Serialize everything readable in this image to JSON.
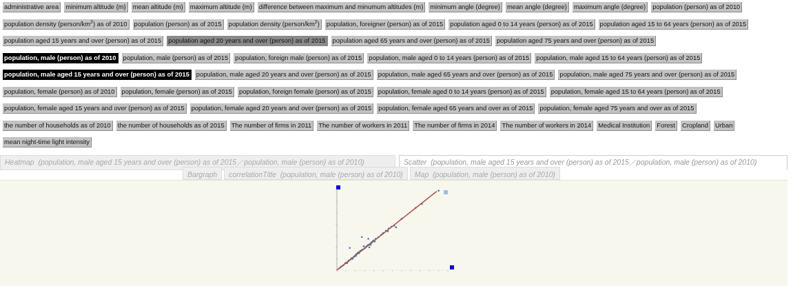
{
  "tag_rows": [
    [
      {
        "label": "administrative area",
        "selected": false,
        "highlighted": false
      },
      {
        "label": "minimum altitude (m)",
        "selected": false,
        "highlighted": false
      },
      {
        "label": "mean altitude (m)",
        "selected": false,
        "highlighted": false
      },
      {
        "label": "maximum altitude (m)",
        "selected": false,
        "highlighted": false
      },
      {
        "label": "difference between maximum and minumum altitudes (m)",
        "selected": false,
        "highlighted": false
      },
      {
        "label": "minimum angle (degree)",
        "selected": false,
        "highlighted": false
      },
      {
        "label": "mean angle (degree)",
        "selected": false,
        "highlighted": false
      },
      {
        "label": "maximum angle (degree)",
        "selected": false,
        "highlighted": false
      },
      {
        "label": "population (person) as of 2010",
        "selected": false,
        "highlighted": false
      }
    ],
    [
      {
        "label": "population density (person/km$^{2}$) as of 2010",
        "selected": false,
        "highlighted": false
      },
      {
        "label": "population (person) as of 2015",
        "selected": false,
        "highlighted": false
      },
      {
        "label": "population density (person/km$^{2}$)",
        "selected": false,
        "highlighted": false
      },
      {
        "label": "population, foreigner (person) as of 2015",
        "selected": false,
        "highlighted": false
      },
      {
        "label": "population aged 0 to 14 years (person) as of 2015",
        "selected": false,
        "highlighted": false
      },
      {
        "label": "population aged 15 to 64 years (person) as of 2015",
        "selected": false,
        "highlighted": false
      }
    ],
    [
      {
        "label": "population aged 15 years and over (person) as of 2015",
        "selected": false,
        "highlighted": false
      },
      {
        "label": "population aged 20 years and over (person) as of 2015",
        "selected": false,
        "highlighted": true
      },
      {
        "label": "population aged 65 years and over (person) as of 2015",
        "selected": false,
        "highlighted": false
      },
      {
        "label": "population aged 75 years and over (person) as of 2015",
        "selected": false,
        "highlighted": false
      }
    ],
    [
      {
        "label": "population, male (person) as of 2010",
        "selected": true,
        "highlighted": false
      },
      {
        "label": "population, male (person) as of 2015",
        "selected": false,
        "highlighted": false
      },
      {
        "label": "population, foreign male (person) as of 2015",
        "selected": false,
        "highlighted": false
      },
      {
        "label": "population, male aged 0 to 14 years (person) as of 2015",
        "selected": false,
        "highlighted": false
      },
      {
        "label": "population, male aged 15 to 64 years (person) as of 2015",
        "selected": false,
        "highlighted": false
      }
    ],
    [
      {
        "label": "population, male aged 15 years and over (person) as of 2015",
        "selected": true,
        "highlighted": false
      },
      {
        "label": "population, male aged 20 years and over (person) as of 2015",
        "selected": false,
        "highlighted": false
      },
      {
        "label": "population, male aged 65 years and over (person) as of 2015",
        "selected": false,
        "highlighted": false
      },
      {
        "label": "population, male aged 75 years and over (person) as of 2015",
        "selected": false,
        "highlighted": false
      }
    ],
    [
      {
        "label": "population, female (person) as of 2010",
        "selected": false,
        "highlighted": false
      },
      {
        "label": "population, female (person) as of 2015",
        "selected": false,
        "highlighted": false
      },
      {
        "label": "population, foreign female (person) as of 2015",
        "selected": false,
        "highlighted": false
      },
      {
        "label": "population, female aged 0 to 14 years (person) as of 2015",
        "selected": false,
        "highlighted": false
      },
      {
        "label": "population, female aged 15 to 64 years (person) as of 2015",
        "selected": false,
        "highlighted": false
      }
    ],
    [
      {
        "label": "population, female aged 15 years and over (person) as of 2015",
        "selected": false,
        "highlighted": false
      },
      {
        "label": "population, female aged 20 years and over (person) as of 2015",
        "selected": false,
        "highlighted": false
      },
      {
        "label": "population, female aged 65 years and over as of 2015",
        "selected": false,
        "highlighted": false
      },
      {
        "label": "population, female aged 75 years and over as of 2015",
        "selected": false,
        "highlighted": false
      }
    ],
    [
      {
        "label": "the number of households as of 2010",
        "selected": false,
        "highlighted": false
      },
      {
        "label": "the number of households as of 2015",
        "selected": false,
        "highlighted": false
      },
      {
        "label": "The number of firms in 2011",
        "selected": false,
        "highlighted": false
      },
      {
        "label": "The number of workers in 2011",
        "selected": false,
        "highlighted": false
      },
      {
        "label": "The number of firms in 2014",
        "selected": false,
        "highlighted": false
      },
      {
        "label": "The number of workers in 2014",
        "selected": false,
        "highlighted": false
      },
      {
        "label": "Medical Institution",
        "selected": false,
        "highlighted": false
      },
      {
        "label": "Forest",
        "selected": false,
        "highlighted": false
      },
      {
        "label": "Cropland",
        "selected": false,
        "highlighted": false
      },
      {
        "label": "Urban",
        "selected": false,
        "highlighted": false
      }
    ],
    [
      {
        "label": "mean night-time light intensity",
        "selected": false,
        "highlighted": false
      }
    ]
  ],
  "tab_rows": [
    [
      {
        "kind": "Heatmap",
        "label": "Heatmap",
        "detail": "(population, male aged 15 years and over (person) as of 2015／population, male (person) as of 2010)",
        "selected": false
      },
      {
        "kind": "Scatter",
        "label": "Scatter",
        "detail": "(population, male aged 15 years and over (person) as of 2015／population, male (person) as of 2010)",
        "selected": true
      }
    ],
    [
      {
        "kind": "Bargraph",
        "label": "Bargraph",
        "selected": false
      },
      {
        "kind": "correlation",
        "label": "correlationTitle",
        "detail": "(population, male (person) as of 2010)",
        "selected": false
      },
      {
        "kind": "Map",
        "label": "Map",
        "detail": "(population, male (person) as of 2010)",
        "selected": false
      }
    ]
  ]
}
